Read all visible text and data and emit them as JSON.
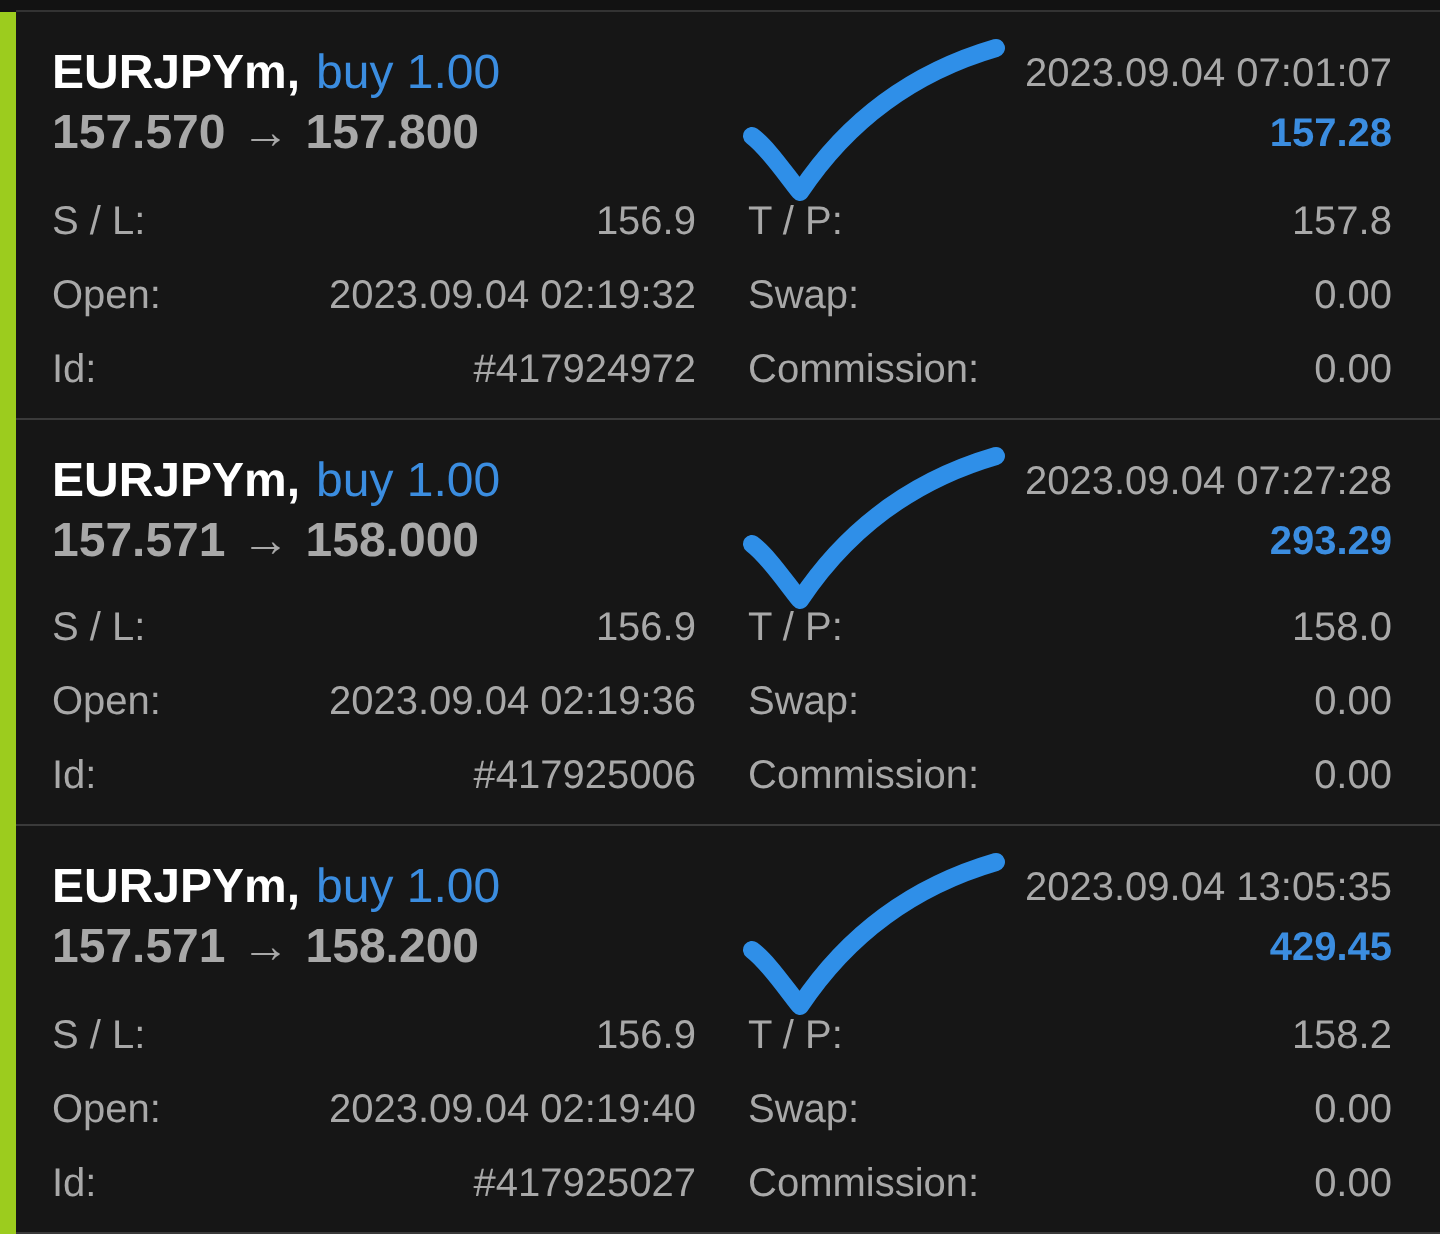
{
  "trades": [
    {
      "symbol": "EURJPYm,",
      "side": "buy 1.00",
      "open_price": "157.570",
      "arrow": "→",
      "close_price": "157.800",
      "time": "2023.09.04 07:01:07",
      "profit": "157.28",
      "fields": [
        {
          "label": "S / L:",
          "value": "156.9",
          "label2": "T / P:",
          "value2": "157.8"
        },
        {
          "label": "Open:",
          "value": "2023.09.04 02:19:32",
          "label2": "Swap:",
          "value2": "0.00"
        },
        {
          "label": "Id:",
          "value": "#417924972",
          "label2": "Commission:",
          "value2": "0.00"
        }
      ]
    },
    {
      "symbol": "EURJPYm,",
      "side": "buy 1.00",
      "open_price": "157.571",
      "arrow": "→",
      "close_price": "158.000",
      "time": "2023.09.04 07:27:28",
      "profit": "293.29",
      "fields": [
        {
          "label": "S / L:",
          "value": "156.9",
          "label2": "T / P:",
          "value2": "158.0"
        },
        {
          "label": "Open:",
          "value": "2023.09.04 02:19:36",
          "label2": "Swap:",
          "value2": "0.00"
        },
        {
          "label": "Id:",
          "value": "#417925006",
          "label2": "Commission:",
          "value2": "0.00"
        }
      ]
    },
    {
      "symbol": "EURJPYm,",
      "side": "buy 1.00",
      "open_price": "157.571",
      "arrow": "→",
      "close_price": "158.200",
      "time": "2023.09.04 13:05:35",
      "profit": "429.45",
      "fields": [
        {
          "label": "S / L:",
          "value": "156.9",
          "label2": "T / P:",
          "value2": "158.2"
        },
        {
          "label": "Open:",
          "value": "2023.09.04 02:19:40",
          "label2": "Swap:",
          "value2": "0.00"
        },
        {
          "label": "Id:",
          "value": "#417925027",
          "label2": "Commission:",
          "value2": "0.00"
        }
      ]
    }
  ]
}
